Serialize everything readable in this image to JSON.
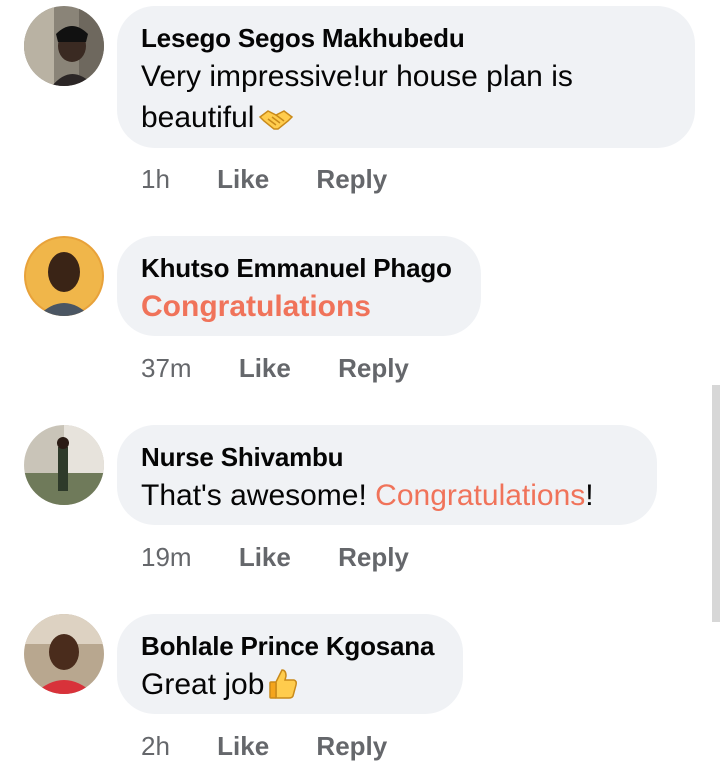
{
  "comments": [
    {
      "author": "Lesego Segos Makhubedu",
      "text_line1": "Very impressive!ur house plan is",
      "text_line2": "beautiful",
      "emoji": "handshake-icon",
      "time": "1h",
      "like": "Like",
      "reply": "Reply"
    },
    {
      "author": "Khutso Emmanuel Phago",
      "text": "Congratulations",
      "time": "37m",
      "like": "Like",
      "reply": "Reply"
    },
    {
      "author": "Nurse Shivambu",
      "text_before": "That's awesome! ",
      "text_highlight": "Congratulations",
      "text_after": "!",
      "time": "19m",
      "like": "Like",
      "reply": "Reply"
    },
    {
      "author": "Bohlale Prince Kgosana",
      "text": "Great job",
      "emoji": "thumbs-up-icon",
      "time": "2h",
      "like": "Like",
      "reply": "Reply"
    }
  ],
  "colors": {
    "bubble": "#f0f2f5",
    "highlight": "#f0735a",
    "meta": "#65676b"
  }
}
